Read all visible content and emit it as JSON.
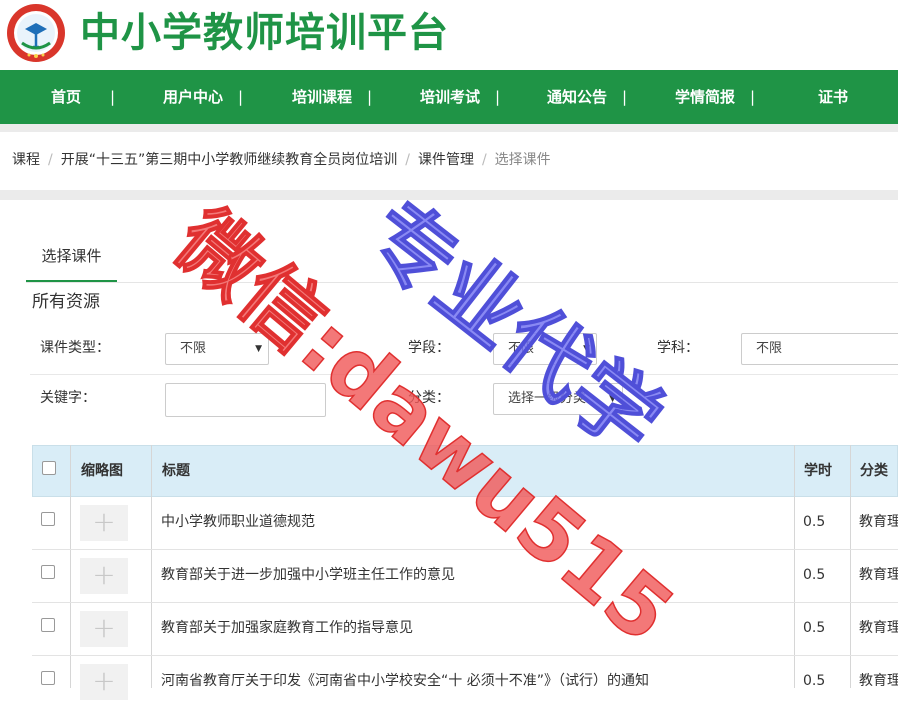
{
  "header": {
    "logo_alt": "logo-emblem",
    "title": "中小学教师培训平台"
  },
  "nav": {
    "items": [
      "首页",
      "用户中心",
      "培训课程",
      "培训考试",
      "通知公告",
      "学情简报",
      "证书"
    ],
    "separator": "|"
  },
  "breadcrumb": {
    "items": [
      "课程",
      "开展“十三五”第三期中小学教师继续教育全员岗位培训",
      "课件管理",
      "选择课件"
    ],
    "separator": "/"
  },
  "tab": {
    "label": "选择课件"
  },
  "section": {
    "title": "所有资源"
  },
  "filters": {
    "type_label": "课件类型：",
    "type_value": "不限",
    "stage_label": "学段：",
    "stage_value": "不限",
    "subject_label": "学科：",
    "subject_value": "不限",
    "keyword_label": "关键字：",
    "keyword_value": "",
    "category_label": "分类：",
    "category_value": "选择一级分类"
  },
  "table": {
    "headers": {
      "thumb": "缩略图",
      "title": "标题",
      "hours": "学时",
      "category": "分类"
    },
    "rows": [
      {
        "title": "中小学教师职业道德规范",
        "hours": "0.5",
        "category": "教育理"
      },
      {
        "title": "教育部关于进一步加强中小学班主任工作的意见",
        "hours": "0.5",
        "category": "教育理"
      },
      {
        "title": "教育部关于加强家庭教育工作的指导意见",
        "hours": "0.5",
        "category": "教育理"
      },
      {
        "title": "河南省教育厅关于印发《河南省中小学校安全“十 必须十不准”》（试行）的通知",
        "hours": "0.5",
        "category": "教育理"
      }
    ]
  },
  "watermark": {
    "line1": "微信:dawu515",
    "line2": "专业代学",
    "color1": "#f05a5a",
    "color2": "#6f6ff0"
  },
  "colors": {
    "brand": "#1f9446",
    "table_header": "#d9edf7"
  }
}
